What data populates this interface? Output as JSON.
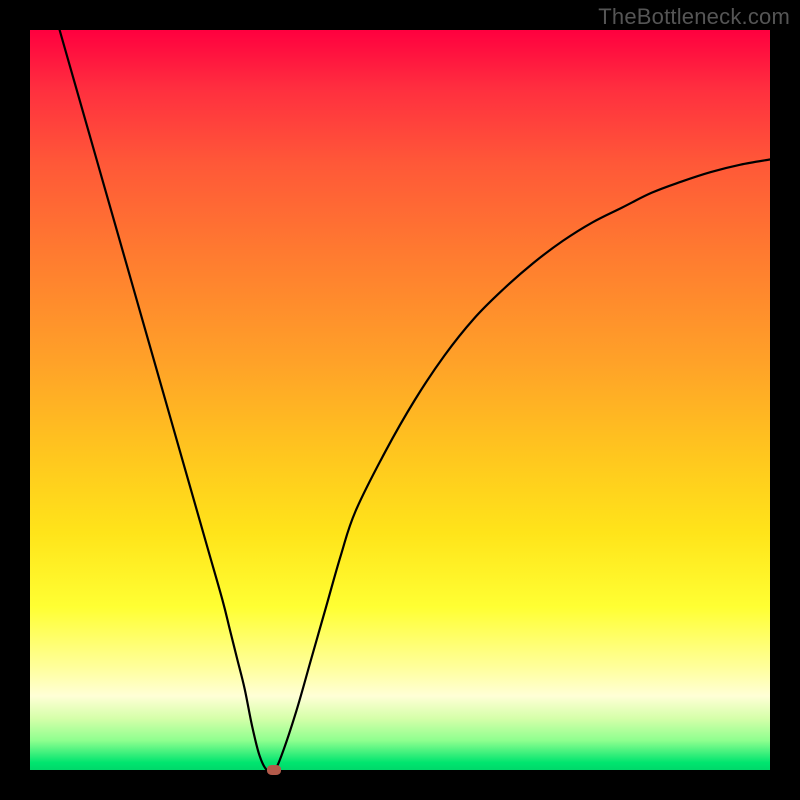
{
  "watermark": "TheBottleneck.com",
  "chart_data": {
    "type": "line",
    "title": "",
    "xlabel": "",
    "ylabel": "",
    "xlim": [
      0,
      100
    ],
    "ylim": [
      0,
      100
    ],
    "series": [
      {
        "name": "bottleneck-curve",
        "x": [
          4,
          6,
          8,
          10,
          12,
          14,
          16,
          18,
          20,
          22,
          24,
          26,
          27,
          28,
          29,
          30,
          31,
          32,
          33,
          34,
          36,
          38,
          40,
          42,
          44,
          48,
          52,
          56,
          60,
          64,
          68,
          72,
          76,
          80,
          84,
          88,
          92,
          96,
          100
        ],
        "values": [
          100,
          93,
          86,
          79,
          72,
          65,
          58,
          51,
          44,
          37,
          30,
          23,
          19,
          15,
          11,
          6,
          2,
          0,
          0,
          2,
          8,
          15,
          22,
          29,
          35,
          43,
          50,
          56,
          61,
          65,
          68.5,
          71.5,
          74,
          76,
          78,
          79.5,
          80.8,
          81.8,
          82.5
        ]
      }
    ],
    "marker": {
      "x": 33,
      "y": 0
    },
    "gradient_stops": [
      {
        "pct": 0,
        "color": "#ff003f"
      },
      {
        "pct": 18,
        "color": "#ff5838"
      },
      {
        "pct": 45,
        "color": "#ffa228"
      },
      {
        "pct": 68,
        "color": "#ffe41a"
      },
      {
        "pct": 86,
        "color": "#ffff9a"
      },
      {
        "pct": 96,
        "color": "#8fff8f"
      },
      {
        "pct": 100,
        "color": "#00d86a"
      }
    ]
  }
}
